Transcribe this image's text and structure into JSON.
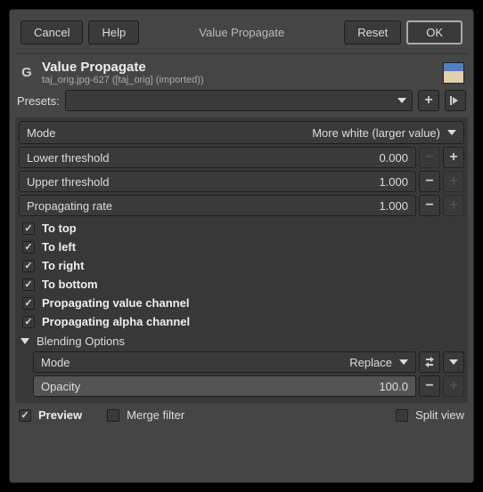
{
  "buttons": {
    "cancel": "Cancel",
    "help": "Help",
    "breadcrumb": "Value Propagate",
    "reset": "Reset",
    "ok": "OK"
  },
  "header": {
    "title": "Value Propagate",
    "subtitle": "taj_orig.jpg-627 ([taj_orig] (imported))"
  },
  "presets": {
    "label": "Presets:"
  },
  "mode": {
    "label": "Mode",
    "value": "More white (larger value)"
  },
  "spinners": {
    "lower_threshold": {
      "label": "Lower threshold",
      "value": "0.000"
    },
    "upper_threshold": {
      "label": "Upper threshold",
      "value": "1.000"
    },
    "propagating_rate": {
      "label": "Propagating rate",
      "value": "1.000"
    }
  },
  "checkboxes": {
    "to_top": "To top",
    "to_left": "To left",
    "to_right": "To right",
    "to_bottom": "To bottom",
    "prop_value": "Propagating value channel",
    "prop_alpha": "Propagating alpha channel"
  },
  "blending": {
    "title": "Blending Options",
    "mode_label": "Mode",
    "mode_value": "Replace",
    "opacity_label": "Opacity",
    "opacity_value": "100.0"
  },
  "footer": {
    "preview": "Preview",
    "merge_filter": "Merge filter",
    "split_view": "Split view"
  }
}
